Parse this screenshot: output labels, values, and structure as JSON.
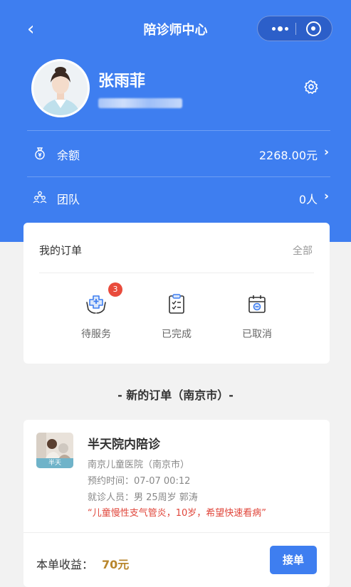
{
  "nav": {
    "title": "陪诊师中心"
  },
  "profile": {
    "name": "张雨菲"
  },
  "balance": {
    "label": "余额",
    "value": "2268.00元"
  },
  "team": {
    "label": "团队",
    "value": "0人"
  },
  "orders": {
    "title": "我的订单",
    "all_label": "全部",
    "items": [
      {
        "label": "待服务",
        "badge": "3",
        "icon": "hands-medical-icon"
      },
      {
        "label": "已完成",
        "icon": "clipboard-check-icon"
      },
      {
        "label": "已取消",
        "icon": "calendar-cancel-icon"
      }
    ]
  },
  "new_orders": {
    "section_title": "- 新的订单（南京市）-",
    "card": {
      "tag": "半天",
      "service": "半天院内陪诊",
      "hospital": "南京儿童医院（南京市）",
      "appointment": "预约时间：07-07 00:12",
      "patient": "就诊人员：男 25周岁 郭涛",
      "remark": "“儿童慢性支气管炎，10岁，希望快速看病”",
      "income_label": "本单收益：",
      "income_value": "70元",
      "accept_label": "接单"
    }
  },
  "colors": {
    "primary": "#3e7ef0",
    "badge": "#e94b3c",
    "income": "#b8862c",
    "remark": "#e0453a"
  }
}
